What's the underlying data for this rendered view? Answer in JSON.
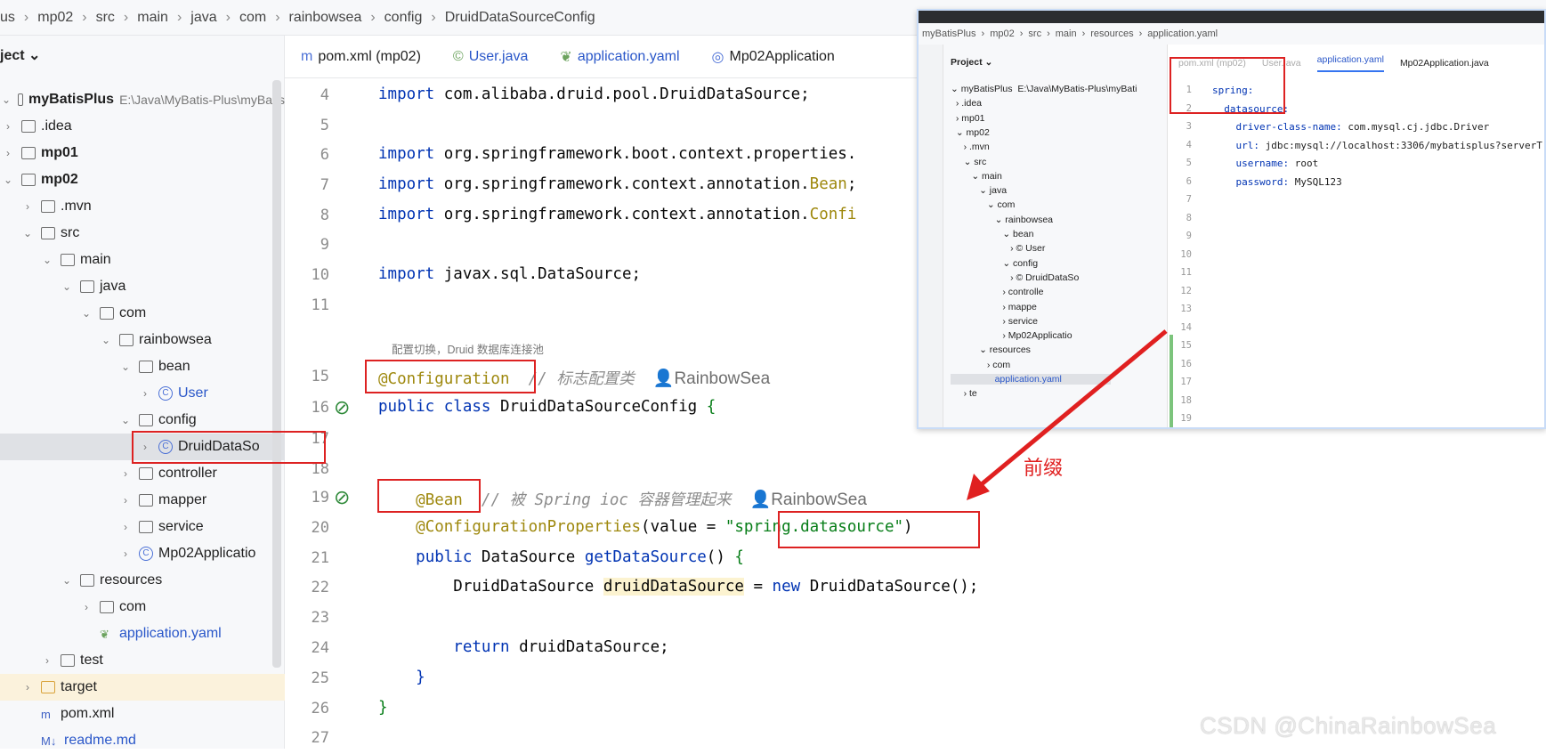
{
  "breadcrumb": [
    "us",
    "mp02",
    "src",
    "main",
    "java",
    "com",
    "rainbowsea",
    "config",
    "DruidDataSourceConfig"
  ],
  "project": {
    "header": "ject ⌄",
    "root_path": "E:\\Java\\MyBatis-Plus\\myBatis",
    "tree": [
      {
        "label": "myBatisPlus",
        "depth": 0,
        "chev": "⌄",
        "icon": "module",
        "bold": true
      },
      {
        "label": ".idea",
        "depth": 0,
        "chev": "›",
        "icon": "folder"
      },
      {
        "label": "mp01",
        "depth": 0,
        "chev": "›",
        "icon": "module",
        "bold": true
      },
      {
        "label": "mp02",
        "depth": 0,
        "chev": "⌄",
        "icon": "module",
        "bold": true
      },
      {
        "label": ".mvn",
        "depth": 1,
        "chev": "›",
        "icon": "folder"
      },
      {
        "label": "src",
        "depth": 1,
        "chev": "⌄",
        "icon": "folder"
      },
      {
        "label": "main",
        "depth": 2,
        "chev": "⌄",
        "icon": "folder"
      },
      {
        "label": "java",
        "depth": 3,
        "chev": "⌄",
        "icon": "folder"
      },
      {
        "label": "com",
        "depth": 4,
        "chev": "⌄",
        "icon": "package"
      },
      {
        "label": "rainbowsea",
        "depth": 5,
        "chev": "⌄",
        "icon": "package"
      },
      {
        "label": "bean",
        "depth": 6,
        "chev": "⌄",
        "icon": "package"
      },
      {
        "label": "User",
        "depth": 7,
        "chev": "›",
        "icon": "class",
        "blue": true
      },
      {
        "label": "config",
        "depth": 6,
        "chev": "⌄",
        "icon": "package"
      },
      {
        "label": "DruidDataSo",
        "depth": 7,
        "chev": "›",
        "icon": "class",
        "selected": true
      },
      {
        "label": "controller",
        "depth": 6,
        "chev": "›",
        "icon": "package"
      },
      {
        "label": "mapper",
        "depth": 6,
        "chev": "›",
        "icon": "package"
      },
      {
        "label": "service",
        "depth": 6,
        "chev": "›",
        "icon": "package"
      },
      {
        "label": "Mp02Applicatio",
        "depth": 6,
        "chev": "›",
        "icon": "class"
      },
      {
        "label": "resources",
        "depth": 3,
        "chev": "⌄",
        "icon": "folder"
      },
      {
        "label": "com",
        "depth": 4,
        "chev": "›",
        "icon": "folder"
      },
      {
        "label": "application.yaml",
        "depth": 4,
        "chev": "",
        "icon": "yaml",
        "blue": true
      },
      {
        "label": "test",
        "depth": 2,
        "chev": "›",
        "icon": "folder"
      },
      {
        "label": "target",
        "depth": 1,
        "chev": "›",
        "icon": "folder-excluded",
        "excluded": true
      },
      {
        "label": "pom.xml",
        "depth": 1,
        "chev": "",
        "icon": "maven"
      },
      {
        "label": "readme.md",
        "depth": 1,
        "chev": "",
        "icon": "markdown",
        "blue": true
      }
    ]
  },
  "tabs": [
    {
      "icon": "m",
      "label": "pom.xml (mp02)"
    },
    {
      "icon": "©",
      "label": "User.java",
      "blue": true
    },
    {
      "icon": "❦",
      "label": "application.yaml",
      "blue": true
    },
    {
      "icon": "◎",
      "label": "Mp02Application"
    }
  ],
  "code": [
    {
      "n": "4",
      "t": [
        [
          "kw",
          "import "
        ],
        [
          "",
          "com.alibaba.druid.pool.DruidDataSource;"
        ]
      ]
    },
    {
      "n": "5",
      "t": []
    },
    {
      "n": "6",
      "t": [
        [
          "kw",
          "import "
        ],
        [
          "",
          "org.springframework.boot.context.properties."
        ]
      ]
    },
    {
      "n": "7",
      "t": [
        [
          "kw",
          "import "
        ],
        [
          "",
          "org.springframework.context.annotation."
        ],
        [
          "an",
          "Bean"
        ],
        [
          "",
          ";"
        ]
      ]
    },
    {
      "n": "8",
      "t": [
        [
          "kw",
          "import "
        ],
        [
          "",
          "org.springframework.context.annotation."
        ],
        [
          "an",
          "Confi"
        ]
      ]
    },
    {
      "n": "9",
      "t": []
    },
    {
      "n": "10",
      "t": [
        [
          "kw",
          "import "
        ],
        [
          "",
          "javax.sql.DataSource;"
        ]
      ]
    },
    {
      "n": "11",
      "t": []
    },
    {
      "n": "",
      "hint": "配置切换，Druid 数据库连接池",
      "t": []
    },
    {
      "n": "15",
      "t": [
        [
          "an",
          "@Configuration"
        ],
        [
          "",
          " "
        ],
        [
          "cm",
          " // 标志配置类  "
        ],
        [
          "au",
          "👤RainbowSea"
        ]
      ]
    },
    {
      "n": "16",
      "t": [
        [
          "kw",
          "public class "
        ],
        [
          "",
          "DruidDataSourceConfig "
        ],
        [
          "st",
          "{"
        ]
      ]
    },
    {
      "n": "17",
      "t": []
    },
    {
      "n": "18",
      "t": []
    },
    {
      "n": "19",
      "t": [
        [
          "",
          "    "
        ],
        [
          "an",
          "@Bean"
        ],
        [
          "cm",
          "  // 被 Spring ioc 容器管理起来  "
        ],
        [
          "au",
          "👤RainbowSea"
        ]
      ]
    },
    {
      "n": "20",
      "t": [
        [
          "",
          "    "
        ],
        [
          "an",
          "@ConfigurationProperties"
        ],
        [
          "",
          "(value = "
        ],
        [
          "st",
          "\"spring.datasource\""
        ],
        [
          "",
          ")"
        ]
      ]
    },
    {
      "n": "21",
      "t": [
        [
          "",
          "    "
        ],
        [
          "kw",
          "public "
        ],
        [
          "",
          "DataSource "
        ],
        [
          "kw",
          "getDataSource"
        ],
        [
          "",
          "() "
        ],
        [
          "st",
          "{"
        ]
      ]
    },
    {
      "n": "22",
      "t": [
        [
          "",
          "        DruidDataSource "
        ],
        [
          "hl",
          "druidDataSource"
        ],
        [
          "",
          " = "
        ],
        [
          "kw",
          "new "
        ],
        [
          "",
          "DruidDataSource();"
        ]
      ]
    },
    {
      "n": "23",
      "t": []
    },
    {
      "n": "24",
      "t": [
        [
          "",
          "        "
        ],
        [
          "kw",
          "return "
        ],
        [
          "",
          "druidDataSource;"
        ]
      ]
    },
    {
      "n": "25",
      "t": [
        [
          "",
          "    "
        ],
        [
          "kw",
          "}"
        ]
      ]
    },
    {
      "n": "26",
      "t": [
        [
          "st",
          "}"
        ]
      ]
    },
    {
      "n": "27",
      "t": []
    }
  ],
  "inset": {
    "breadcrumb": [
      "myBatisPlus",
      "mp02",
      "src",
      "main",
      "resources",
      "application.yaml"
    ],
    "project_header": "Project ⌄",
    "tree": [
      "⌄ myBatisPlus  E:\\Java\\MyBatis-Plus\\myBati",
      "  › .idea",
      "  › mp01",
      "  ⌄ mp02",
      "     › .mvn",
      "     ⌄ src",
      "        ⌄ main",
      "           ⌄ java",
      "              ⌄ com",
      "                 ⌄ rainbowsea",
      "                    ⌄ bean",
      "                       › © User",
      "                    ⌄ config",
      "                       › © DruidDataSo",
      "                    › controlle",
      "                    › mappe",
      "                    › service",
      "                    › Mp02Applicatio",
      "           ⌄ resources",
      "              › com",
      "                 application.yaml",
      "     › te"
    ],
    "tabs": [
      "pom.xml (mp02)",
      "User.java",
      "application.yaml",
      "Mp02Application.java"
    ],
    "yaml": [
      [
        "1",
        "spring:",
        ""
      ],
      [
        "2",
        "  datasource:",
        ""
      ],
      [
        "3",
        "    driver-class-name:",
        " com.mysql.cj.jdbc.Driver"
      ],
      [
        "4",
        "    url:",
        " jdbc:mysql://localhost:3306/mybatisplus?serverT"
      ],
      [
        "5",
        "    username:",
        " root"
      ],
      [
        "6",
        "    password:",
        " MySQL123"
      ],
      [
        "7",
        "",
        ""
      ],
      [
        "8",
        "",
        ""
      ],
      [
        "9",
        "",
        ""
      ],
      [
        "10",
        "",
        ""
      ],
      [
        "11",
        "",
        ""
      ],
      [
        "12",
        "",
        ""
      ],
      [
        "13",
        "",
        ""
      ],
      [
        "14",
        "",
        ""
      ],
      [
        "15",
        "",
        ""
      ],
      [
        "16",
        "",
        ""
      ],
      [
        "17",
        "",
        ""
      ],
      [
        "18",
        "",
        ""
      ],
      [
        "19",
        "",
        ""
      ],
      [
        "20",
        "",
        ""
      ]
    ]
  },
  "annotation": {
    "label": "前缀",
    "color": "#e02020"
  },
  "watermark": "CSDN @ChinaRainbowSea"
}
